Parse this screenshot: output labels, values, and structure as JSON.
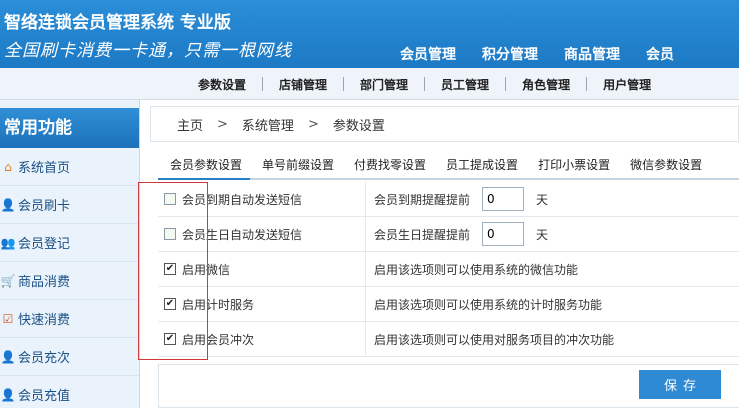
{
  "header": {
    "app_title": "智络连锁会员管理系统 专业版",
    "slogan": "全国刷卡消费一卡通，只需一根网线",
    "nav": [
      "会员管理",
      "积分管理",
      "商品管理",
      "会员"
    ]
  },
  "sub_nav": [
    "参数设置",
    "店铺管理",
    "部门管理",
    "员工管理",
    "角色管理",
    "用户管理"
  ],
  "sidebar": {
    "title": "常用功能",
    "items": [
      {
        "label": "系统首页",
        "icon": "home-icon"
      },
      {
        "label": "会员刷卡",
        "icon": "card-icon"
      },
      {
        "label": "会员登记",
        "icon": "user-add-icon"
      },
      {
        "label": "商品消费",
        "icon": "cart-icon"
      },
      {
        "label": "快速消费",
        "icon": "quick-icon"
      },
      {
        "label": "会员充次",
        "icon": "recharge-count-icon"
      },
      {
        "label": "会员充值",
        "icon": "recharge-icon"
      }
    ]
  },
  "breadcrumb": [
    "主页",
    "系统管理",
    "参数设置"
  ],
  "breadcrumb_sep": ">",
  "tabs": [
    "会员参数设置",
    "单号前缀设置",
    "付费找零设置",
    "员工提成设置",
    "打印小票设置",
    "微信参数设置"
  ],
  "settings": [
    {
      "label": "会员到期自动发送短信",
      "checked": false,
      "desc": "会员到期提醒提前",
      "value": "0",
      "unit": "天"
    },
    {
      "label": "会员生日自动发送短信",
      "checked": false,
      "desc": "会员生日提醒提前",
      "value": "0",
      "unit": "天"
    },
    {
      "label": "启用微信",
      "checked": true,
      "desc": "启用该选项则可以使用系统的微信功能"
    },
    {
      "label": "启用计时服务",
      "checked": true,
      "desc": "启用该选项则可以使用系统的计时服务功能"
    },
    {
      "label": "启用会员冲次",
      "checked": true,
      "desc": "启用该选项则可以使用对服务项目的冲次功能"
    }
  ],
  "save_label": "保存",
  "colors": {
    "header": "#1d79c4",
    "accent": "#2f8ad4",
    "highlight_box": "#d03a3a"
  }
}
